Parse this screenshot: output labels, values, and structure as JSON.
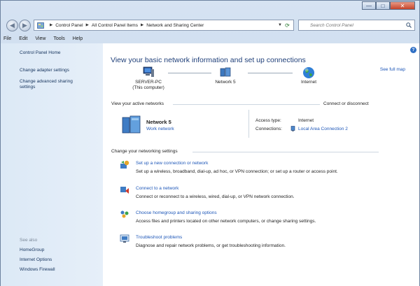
{
  "window": {
    "buttons": {
      "minimize": "—",
      "maximize": "□",
      "close": "✕"
    }
  },
  "address_bar": {
    "breadcrumbs": [
      "Control Panel",
      "All Control Panel Items",
      "Network and Sharing Center"
    ],
    "search_placeholder": "Search Control Panel"
  },
  "menu": [
    "File",
    "Edit",
    "View",
    "Tools",
    "Help"
  ],
  "sidebar": {
    "items": [
      "Control Panel Home",
      "Change adapter settings",
      "Change advanced sharing settings"
    ],
    "see_also_heading": "See also",
    "see_also": [
      "HomeGroup",
      "Internet Options",
      "Windows Firewall"
    ]
  },
  "main": {
    "title": "View your basic network information and set up connections",
    "see_full_map": "See full map",
    "map": {
      "computer": {
        "name": "SERVER-PC",
        "sub": "(This computer)"
      },
      "network": "Network  5",
      "internet": "Internet"
    },
    "active_networks_label": "View your active networks",
    "connect_disconnect": "Connect or disconnect",
    "active_network": {
      "name": "Network  5",
      "type": "Work network",
      "access_type_label": "Access type:",
      "access_type_value": "Internet",
      "connections_label": "Connections:",
      "connections_value": "Local Area Connection 2"
    },
    "change_settings_label": "Change your networking settings",
    "tasks": [
      {
        "title": "Set up a new connection or network",
        "desc": "Set up a wireless, broadband, dial-up, ad hoc, or VPN connection; or set up a router or access point."
      },
      {
        "title": "Connect to a network",
        "desc": "Connect or reconnect to a wireless, wired, dial-up, or VPN network connection."
      },
      {
        "title": "Choose homegroup and sharing options",
        "desc": "Access files and printers located on other network computers, or change sharing settings."
      },
      {
        "title": "Troubleshoot problems",
        "desc": "Diagnose and repair network problems, or get troubleshooting information."
      }
    ]
  }
}
